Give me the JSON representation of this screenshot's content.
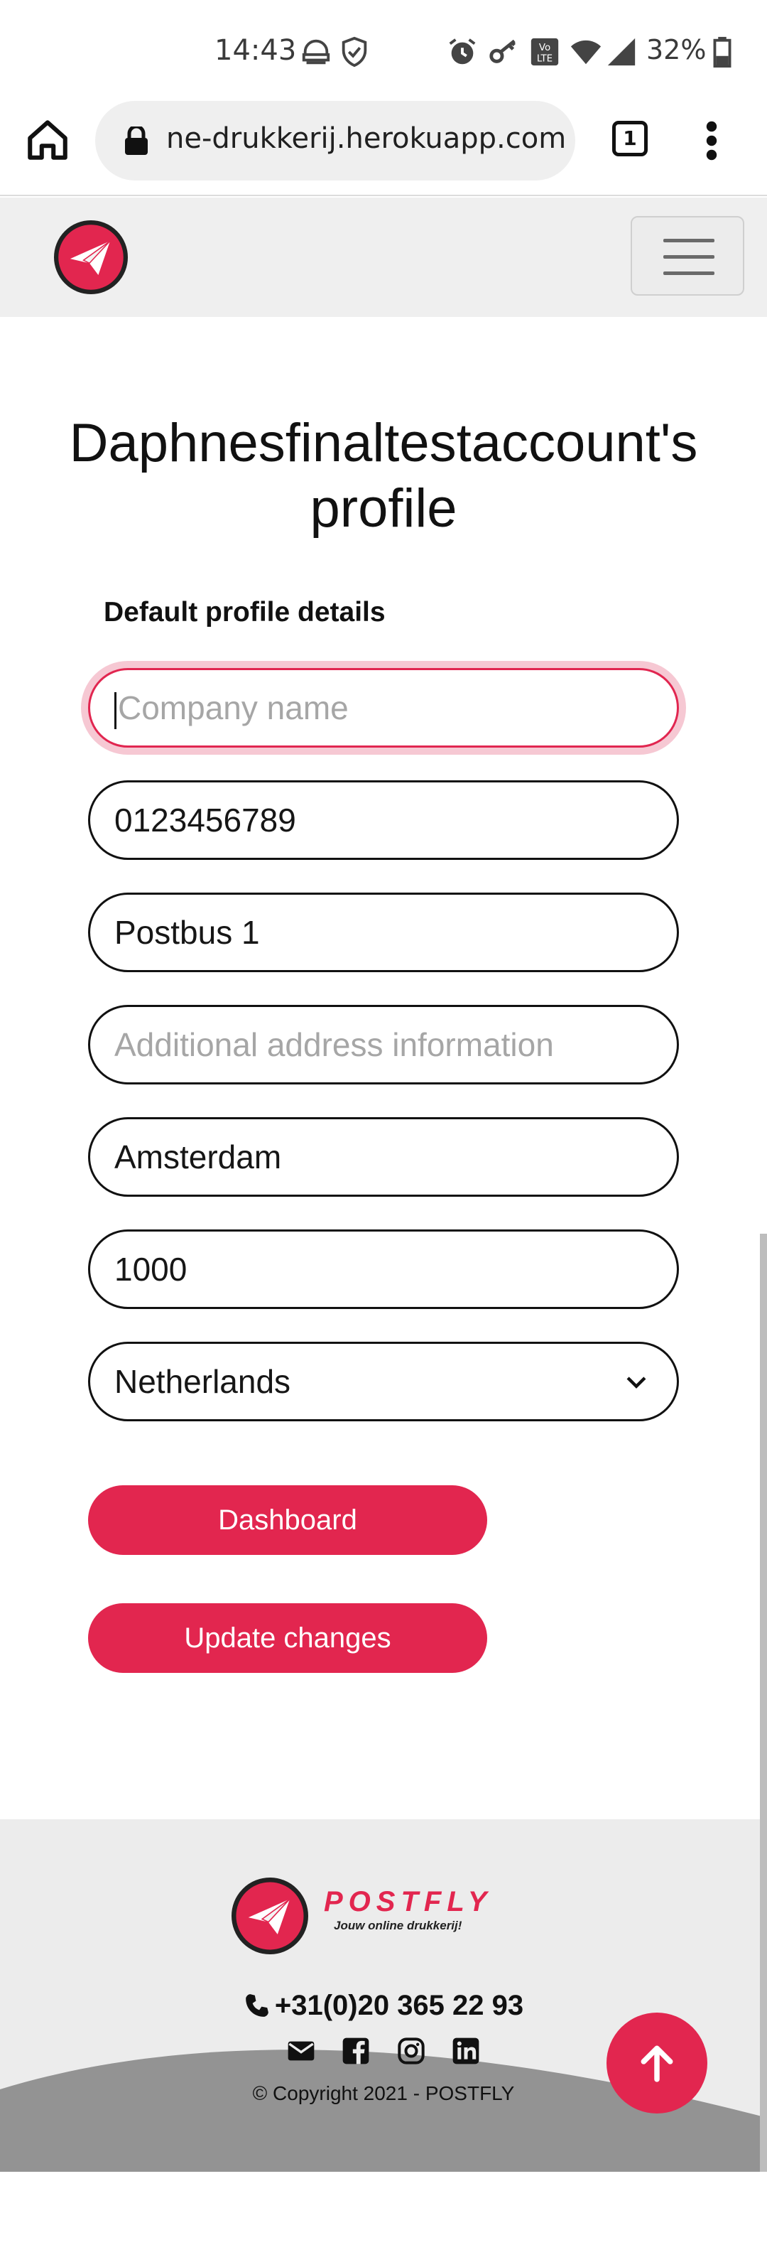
{
  "status_bar": {
    "time": "14:43",
    "battery": "32%",
    "icons": [
      "headset-icon",
      "shield-check-icon",
      "alarm-icon",
      "key-icon",
      "volte-icon",
      "wifi-icon",
      "signal-icon",
      "battery-icon"
    ]
  },
  "browser": {
    "url": "ne-drukkerij.herokuapp.com",
    "tab_count": "1"
  },
  "profile": {
    "title": "Daphnesfinaltestaccount's profile",
    "section_label": "Default profile details",
    "fields": {
      "company": {
        "value": "",
        "placeholder": "Company name"
      },
      "phone": {
        "value": "0123456789",
        "placeholder": ""
      },
      "address": {
        "value": "Postbus 1",
        "placeholder": ""
      },
      "address_extra": {
        "value": "",
        "placeholder": "Additional address information"
      },
      "city": {
        "value": "Amsterdam",
        "placeholder": ""
      },
      "postal_code": {
        "value": "1000",
        "placeholder": ""
      },
      "country": {
        "selected": "Netherlands"
      }
    },
    "buttons": {
      "dashboard": "Dashboard",
      "update": "Update changes"
    }
  },
  "footer": {
    "brand": "POSTFLY",
    "tagline": "Jouw online drukkerij!",
    "phone": "+31(0)20 365 22 93",
    "copyright": "© Copyright 2021 - POSTFLY"
  },
  "colors": {
    "accent": "#e2264f",
    "focus_ring": "#f6c8d3",
    "nav_bg": "#efefef",
    "footer_wave": "#939393"
  }
}
